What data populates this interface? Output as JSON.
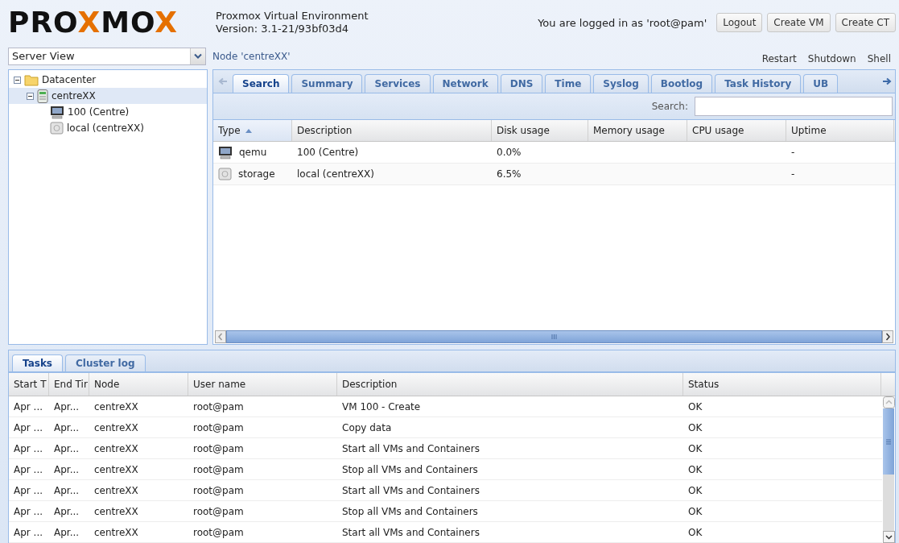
{
  "logo": [
    {
      "text": "PRO",
      "accent": false
    },
    {
      "text": "X",
      "accent": true
    },
    {
      "text": "MO",
      "accent": false
    },
    {
      "text": "X",
      "accent": true
    }
  ],
  "product": {
    "name": "Proxmox Virtual Environment",
    "version": "Version: 3.1-21/93bf03d4"
  },
  "login_text": "You are logged in as 'root@pam'",
  "header_buttons": [
    "Logout",
    "Create VM",
    "Create CT"
  ],
  "view_select": {
    "value": "Server View"
  },
  "tree": [
    {
      "label": "Datacenter",
      "kind": "folder",
      "expanded": true,
      "selected": false,
      "children": [
        {
          "label": "centreXX",
          "kind": "node",
          "expanded": true,
          "selected": true,
          "children": [
            {
              "label": "100 (Centre)",
              "kind": "vm",
              "selected": false
            },
            {
              "label": "local (centreXX)",
              "kind": "storage",
              "selected": false
            }
          ]
        }
      ]
    }
  ],
  "node_title": "Node 'centreXX'",
  "node_actions": [
    "Restart",
    "Shutdown",
    "Shell"
  ],
  "tabs": [
    {
      "label": "Search",
      "selected": true
    },
    {
      "label": "Summary",
      "selected": false
    },
    {
      "label": "Services",
      "selected": false
    },
    {
      "label": "Network",
      "selected": false
    },
    {
      "label": "DNS",
      "selected": false
    },
    {
      "label": "Time",
      "selected": false
    },
    {
      "label": "Syslog",
      "selected": false
    },
    {
      "label": "Bootlog",
      "selected": false
    },
    {
      "label": "Task History",
      "selected": false
    },
    {
      "label": "UB",
      "selected": false
    }
  ],
  "search": {
    "label": "Search:"
  },
  "resources": {
    "columns": [
      {
        "label": "Type",
        "sorted": true
      },
      {
        "label": "Description",
        "sorted": false
      },
      {
        "label": "Disk usage",
        "sorted": false
      },
      {
        "label": "Memory usage",
        "sorted": false
      },
      {
        "label": "CPU usage",
        "sorted": false
      },
      {
        "label": "Uptime",
        "sorted": false
      }
    ],
    "rows": [
      {
        "kind": "vm",
        "cells": [
          "qemu",
          "100 (Centre)",
          "0.0%",
          "",
          "",
          "-"
        ]
      },
      {
        "kind": "storage",
        "cells": [
          "storage",
          "local (centreXX)",
          "6.5%",
          "",
          "",
          "-"
        ]
      }
    ]
  },
  "bottom_tabs": [
    {
      "label": "Tasks",
      "selected": true
    },
    {
      "label": "Cluster log",
      "selected": false
    }
  ],
  "tasks": {
    "columns": [
      "Start T",
      "End Tir",
      "Node",
      "User name",
      "Description",
      "Status"
    ],
    "rows": [
      [
        "Apr ...",
        "Apr...",
        "centreXX",
        "root@pam",
        "VM 100 - Create",
        "OK"
      ],
      [
        "Apr ...",
        "Apr...",
        "centreXX",
        "root@pam",
        "Copy data",
        "OK"
      ],
      [
        "Apr ...",
        "Apr...",
        "centreXX",
        "root@pam",
        "Start all VMs and Containers",
        "OK"
      ],
      [
        "Apr ...",
        "Apr...",
        "centreXX",
        "root@pam",
        "Stop all VMs and Containers",
        "OK"
      ],
      [
        "Apr ...",
        "Apr...",
        "centreXX",
        "root@pam",
        "Start all VMs and Containers",
        "OK"
      ],
      [
        "Apr ...",
        "Apr...",
        "centreXX",
        "root@pam",
        "Stop all VMs and Containers",
        "OK"
      ],
      [
        "Apr ...",
        "Apr...",
        "centreXX",
        "root@pam",
        "Start all VMs and Containers",
        "OK"
      ]
    ]
  }
}
